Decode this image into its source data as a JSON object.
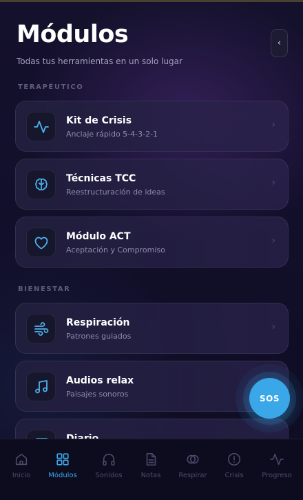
{
  "header": {
    "title": "Módulos",
    "subtitle": "Todas tus herramientas en un solo lugar",
    "back_label": "‹"
  },
  "sections": {
    "therapeutic": "TERAPÉUTICO",
    "wellbeing": "BIENESTAR"
  },
  "cards": [
    {
      "title": "Kit de Crisis",
      "subtitle": "Anclaje rápido 5-4-3-2-1",
      "icon": "pulse-icon"
    },
    {
      "title": "Técnicas TCC",
      "subtitle": "Reestructuración de ideas",
      "icon": "brain-icon"
    },
    {
      "title": "Módulo ACT",
      "subtitle": "Aceptación y Compromiso",
      "icon": "heart-icon"
    },
    {
      "title": "Respiración",
      "subtitle": "Patrones guiados",
      "icon": "wind-icon"
    },
    {
      "title": "Audios relax",
      "subtitle": "Paisajes sonoros",
      "icon": "music-icon"
    },
    {
      "title": "Diario",
      "subtitle": "",
      "icon": "journal-icon"
    }
  ],
  "chevron": "›",
  "sos_label": "SOS",
  "tabs": [
    {
      "label": "Inicio",
      "icon": "home-icon",
      "active": false
    },
    {
      "label": "Módulos",
      "icon": "grid-icon",
      "active": true
    },
    {
      "label": "Sonidos",
      "icon": "headphones-icon",
      "active": false
    },
    {
      "label": "Notas",
      "icon": "document-icon",
      "active": false
    },
    {
      "label": "Respirar",
      "icon": "breathe-icon",
      "active": false
    },
    {
      "label": "Crisis",
      "icon": "alert-icon",
      "active": false
    },
    {
      "label": "Progreso",
      "icon": "activity-icon",
      "active": false
    }
  ],
  "colors": {
    "accent": "#39a7e8",
    "icon": "#4fb3ee",
    "inactive": "#4d4b6a",
    "background": "#120f2a"
  }
}
